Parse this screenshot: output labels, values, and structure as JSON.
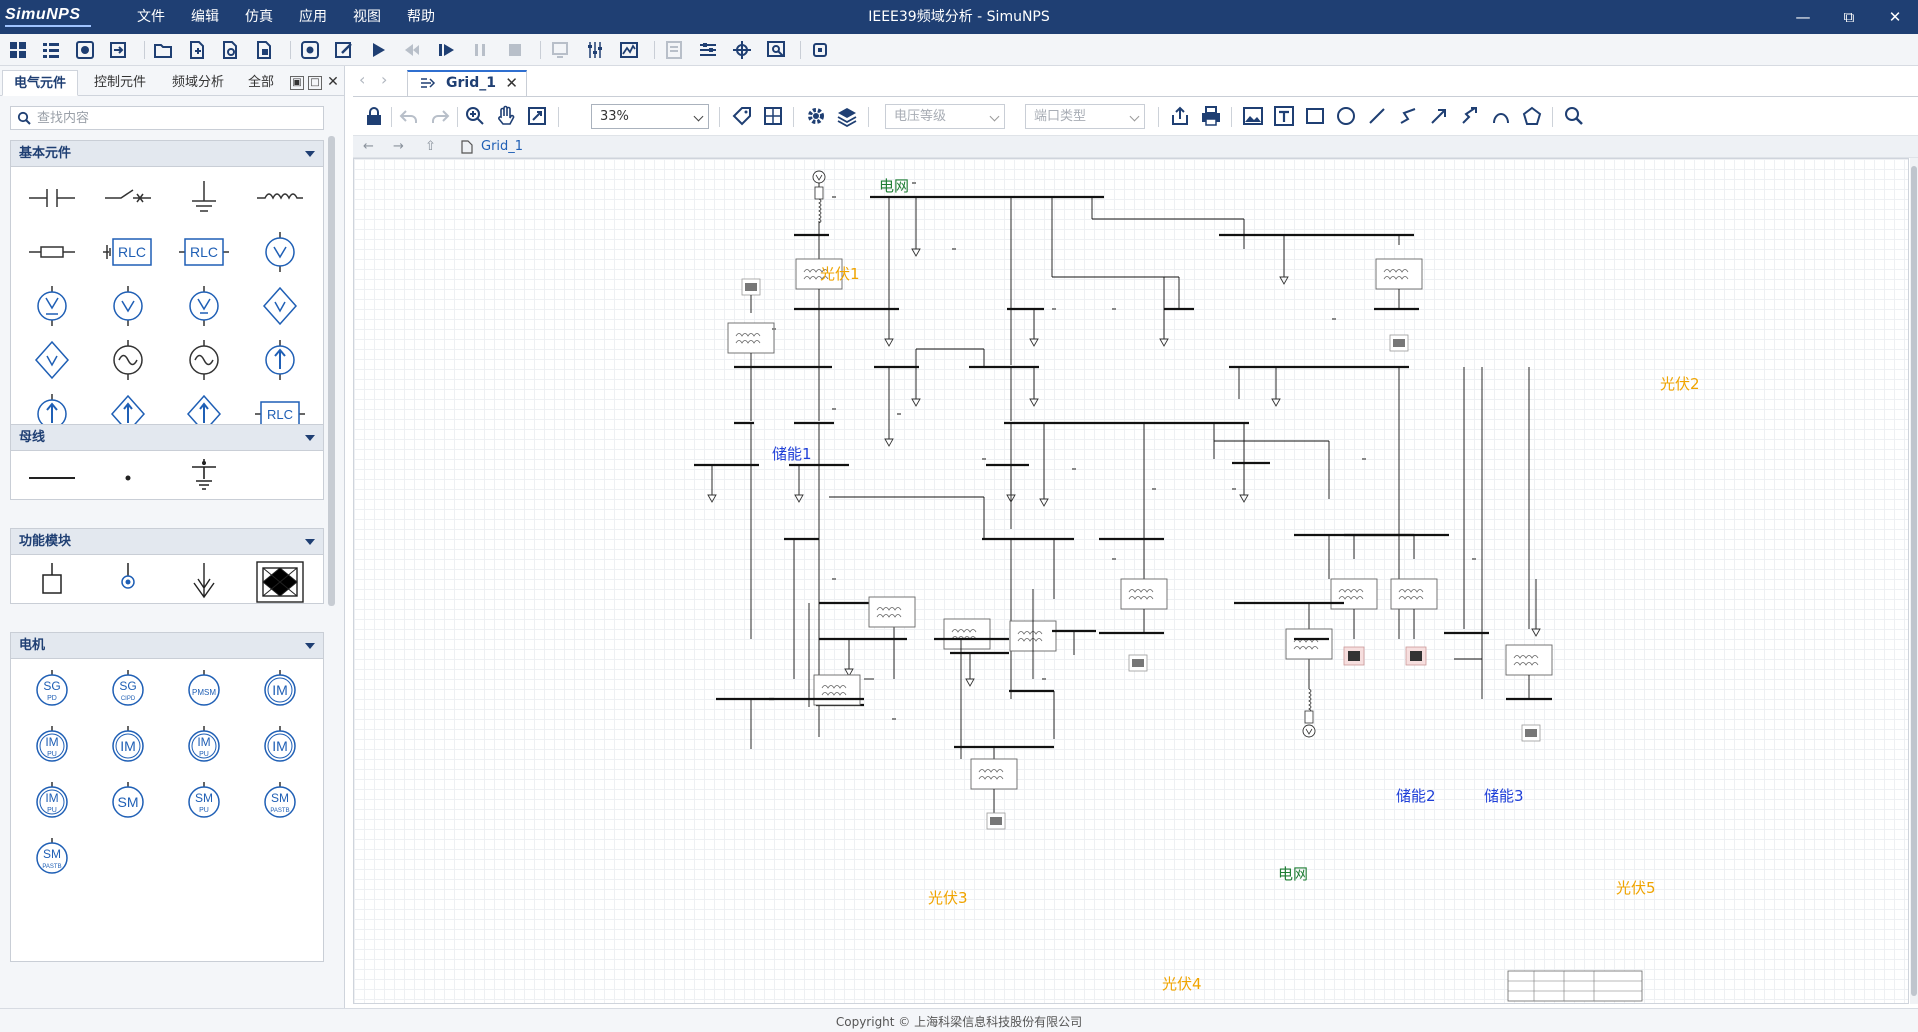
{
  "window": {
    "logo": "SimuNPS",
    "title": "IEEE39频域分析 - SimuNPS",
    "controls": [
      "minimize",
      "restore",
      "close"
    ]
  },
  "menu": [
    "文件",
    "编辑",
    "仿真",
    "应用",
    "视图",
    "帮助"
  ],
  "left_panel": {
    "tabs": [
      "电气元件",
      "控制元件",
      "频域分析",
      "全部"
    ],
    "active_tab": "电气元件",
    "search_placeholder": "查找内容",
    "sections": [
      {
        "title": "基本元件",
        "icons": [
          "capacitor-icon",
          "switch-icon",
          "ground-icon",
          "inductor-icon",
          "resistor-icon",
          "rlc-source-icon",
          "rlc-block-icon",
          "voltage-source-icon",
          "ac-voltage-source-icon",
          "voltage-source-alt-icon",
          "voltage-source-dc-icon",
          "controlled-voltage-diamond-icon",
          "controlled-voltage-diamond-alt-icon",
          "ac-source-icon",
          "ac-source-alt-icon",
          "current-source-icon",
          "current-source-alt-icon",
          "controlled-current-diamond-icon",
          "controlled-current-diamond-alt-icon",
          "rlc-load-icon",
          "rlc-load-alt-icon",
          "voltage-rl-icon"
        ]
      },
      {
        "title": "母线",
        "icons": [
          "busbar-icon",
          "node-icon",
          "grounded-bus-icon"
        ]
      },
      {
        "title": "功能模块",
        "icons": [
          "terminal-icon",
          "port-icon",
          "arrow-down-icon",
          "subsystem-icon"
        ]
      },
      {
        "title": "电机",
        "icons": [
          "sg-pd-icon",
          "sg-cipd-icon",
          "pmsm-icon",
          "im-icon",
          "im-pu-icon",
          "im-alt-icon",
          "im-pu-alt-icon",
          "im-simple-icon",
          "im-pu-3-icon",
          "sm-icon",
          "sm-pu-icon",
          "sm-pastb-icon",
          "sm-pastb-alt-icon"
        ]
      }
    ],
    "machine_labels": {
      "sg": "SG",
      "pd": "PD",
      "cipd": "CIPD",
      "pmsm": "PMSM",
      "im": "IM",
      "pu": "PU",
      "sm": "SM",
      "pastb": "PASTB"
    },
    "rlc": "RLC"
  },
  "document": {
    "tab_label": "Grid_1",
    "zoom": "33%",
    "voltage_level_placeholder": "电压等级",
    "port_type_placeholder": "端口类型",
    "breadcrumb": "Grid_1"
  },
  "diagram_labels": {
    "grid_top": "电网",
    "grid_bottom": "电网",
    "pv1": "光伏1",
    "pv2": "光伏2",
    "pv3": "光伏3",
    "pv4": "光伏4",
    "pv5": "光伏5",
    "es1": "储能1",
    "es2": "储能2",
    "es3": "储能3"
  },
  "status": {
    "copyright": "Copyright © 上海科梁信息科技股份有限公司"
  },
  "colors": {
    "titlebar": "#1f3f73",
    "grid_label": "#1e7d33",
    "pv_label": "#f0a400",
    "storage_label": "#1f3fd8",
    "accent": "#2f6fd0"
  }
}
